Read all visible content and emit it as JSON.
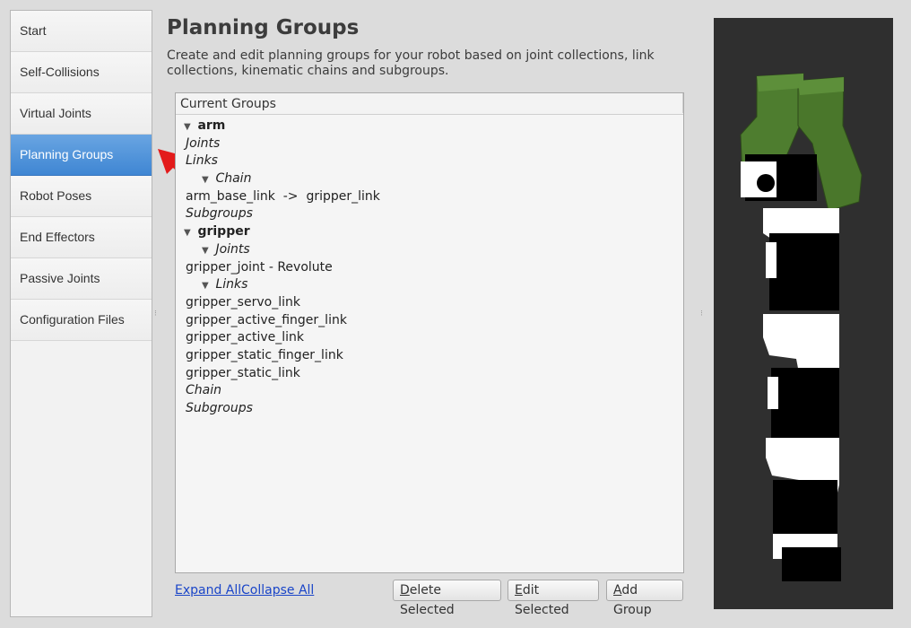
{
  "sidebar": {
    "items": [
      {
        "label": "Start",
        "active": false
      },
      {
        "label": "Self-Collisions",
        "active": false
      },
      {
        "label": "Virtual Joints",
        "active": false
      },
      {
        "label": "Planning Groups",
        "active": true
      },
      {
        "label": "Robot Poses",
        "active": false
      },
      {
        "label": "End Effectors",
        "active": false
      },
      {
        "label": "Passive Joints",
        "active": false
      },
      {
        "label": "Configuration Files",
        "active": false
      }
    ]
  },
  "main": {
    "title": "Planning Groups",
    "description": "Create and edit planning groups for your robot based on joint collections, link collections, kinematic chains and subgroups.",
    "tree": {
      "header": "Current Groups",
      "arm": {
        "name": "arm",
        "joints": "Joints",
        "links": "Links",
        "chain": "Chain",
        "chain_value": "arm_base_link  ->  gripper_link",
        "subgroups": "Subgroups"
      },
      "gripper": {
        "name": "gripper",
        "joints": "Joints",
        "joint_value": "gripper_joint - Revolute",
        "links": "Links",
        "link_values": [
          "gripper_servo_link",
          "gripper_active_finger_link",
          "gripper_active_link",
          "gripper_static_finger_link",
          "gripper_static_link"
        ],
        "chain": "Chain",
        "subgroups": "Subgroups"
      }
    },
    "links": {
      "expand_all": "Expand All",
      "collapse_all": "Collapse All"
    },
    "buttons": {
      "delete": {
        "mnemonic": "D",
        "rest": "elete Selected"
      },
      "edit": {
        "mnemonic": "E",
        "rest": "dit Selected"
      },
      "add": {
        "mnemonic": "A",
        "rest": "dd Group"
      }
    }
  },
  "annotation": {
    "color": "#e31b1b",
    "icon": "red-arrow"
  },
  "colors": {
    "active_nav": "#4a90d9",
    "gripper_green": "#4a7a2c",
    "viewport_bg": "#2f2f2f"
  }
}
